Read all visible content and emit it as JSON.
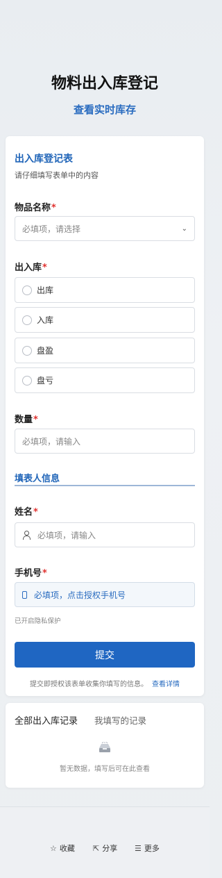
{
  "header": {
    "title": "物料出入库登记",
    "subtitle": "查看实时库存"
  },
  "form": {
    "section_title": "出入库登记表",
    "section_desc": "请仔细填写表单中的内容",
    "item_name": {
      "label": "物品名称",
      "placeholder": "必填项，请选择"
    },
    "io_type": {
      "label": "出入库",
      "options": [
        "出库",
        "入库",
        "盘盈",
        "盘亏"
      ]
    },
    "quantity": {
      "label": "数量",
      "placeholder": "必填项，请输入"
    },
    "filler_group_title": "填表人信息",
    "name": {
      "label": "姓名",
      "placeholder": "必填项，请输入"
    },
    "phone": {
      "label": "手机号",
      "placeholder": "必填项，点击授权手机号"
    },
    "privacy_note": "已开启隐私保护",
    "submit_label": "提交",
    "consent_text": "提交即授权该表单收集你填写的信息。",
    "consent_link": "查看详情",
    "required_mark": "*"
  },
  "records": {
    "tabs": [
      "全部出入库记录",
      "我填写的记录"
    ],
    "empty_text": "暂无数据，填写后可在此查看"
  },
  "bottom_bar": {
    "items": [
      {
        "label": "收藏",
        "icon": "star-icon"
      },
      {
        "label": "分享",
        "icon": "share-icon"
      },
      {
        "label": "更多",
        "icon": "menu-icon"
      }
    ]
  },
  "colors": {
    "accent": "#1f66c2",
    "required": "#e0322f"
  }
}
